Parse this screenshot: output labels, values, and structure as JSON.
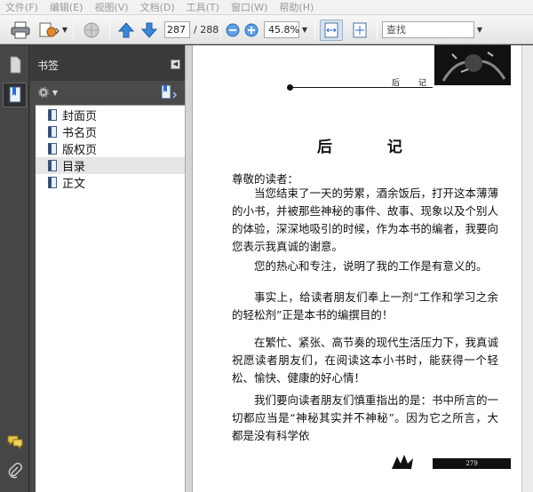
{
  "menubar": {
    "items": [
      "文件(F)",
      "编辑(E)",
      "视图(V)",
      "文档(D)",
      "工具(T)",
      "窗口(W)",
      "帮助(H)"
    ]
  },
  "toolbar": {
    "print_icon": "printer-icon",
    "current_page": "287",
    "page_total": "/ 288",
    "zoom_value": "45.8%",
    "find_placeholder": "查找"
  },
  "bookmarks": {
    "title": "书签",
    "items": [
      "封面页",
      "书名页",
      "版权页",
      "目录",
      "正文"
    ],
    "selected_index": 3
  },
  "document": {
    "header_text": "后 记",
    "title": "后 记",
    "salutation": "尊敬的读者：",
    "paragraphs": [
      "当您结束了一天的劳累，酒余饭后，打开这本薄薄的小书，并被那些神秘的事件、故事、现象以及个别人的体验，深深地吸引的时候，作为本书的编者，我要向您表示我真诚的谢意。",
      "您的热心和专注，说明了我的工作是有意义的。",
      "事实上，给读者朋友们奉上一剂“工作和学习之余的轻松剂”正是本书的编撰目的！",
      "在繁忙、紧张、高节奏的现代生活压力下，我真诚祝愿读者朋友们，在阅读这本小书时，能获得一个轻松、愉快、健康的好心情！",
      "我们要向读者朋友们慎重指出的是：书中所言的一切都应当是“神秘其实并不神秘”。因为它之所言，大都是没有科学依"
    ],
    "page_number": "279"
  },
  "colors": {
    "panel_dark": "#3a3a3a",
    "accent_blue": "#2e6bd0"
  }
}
